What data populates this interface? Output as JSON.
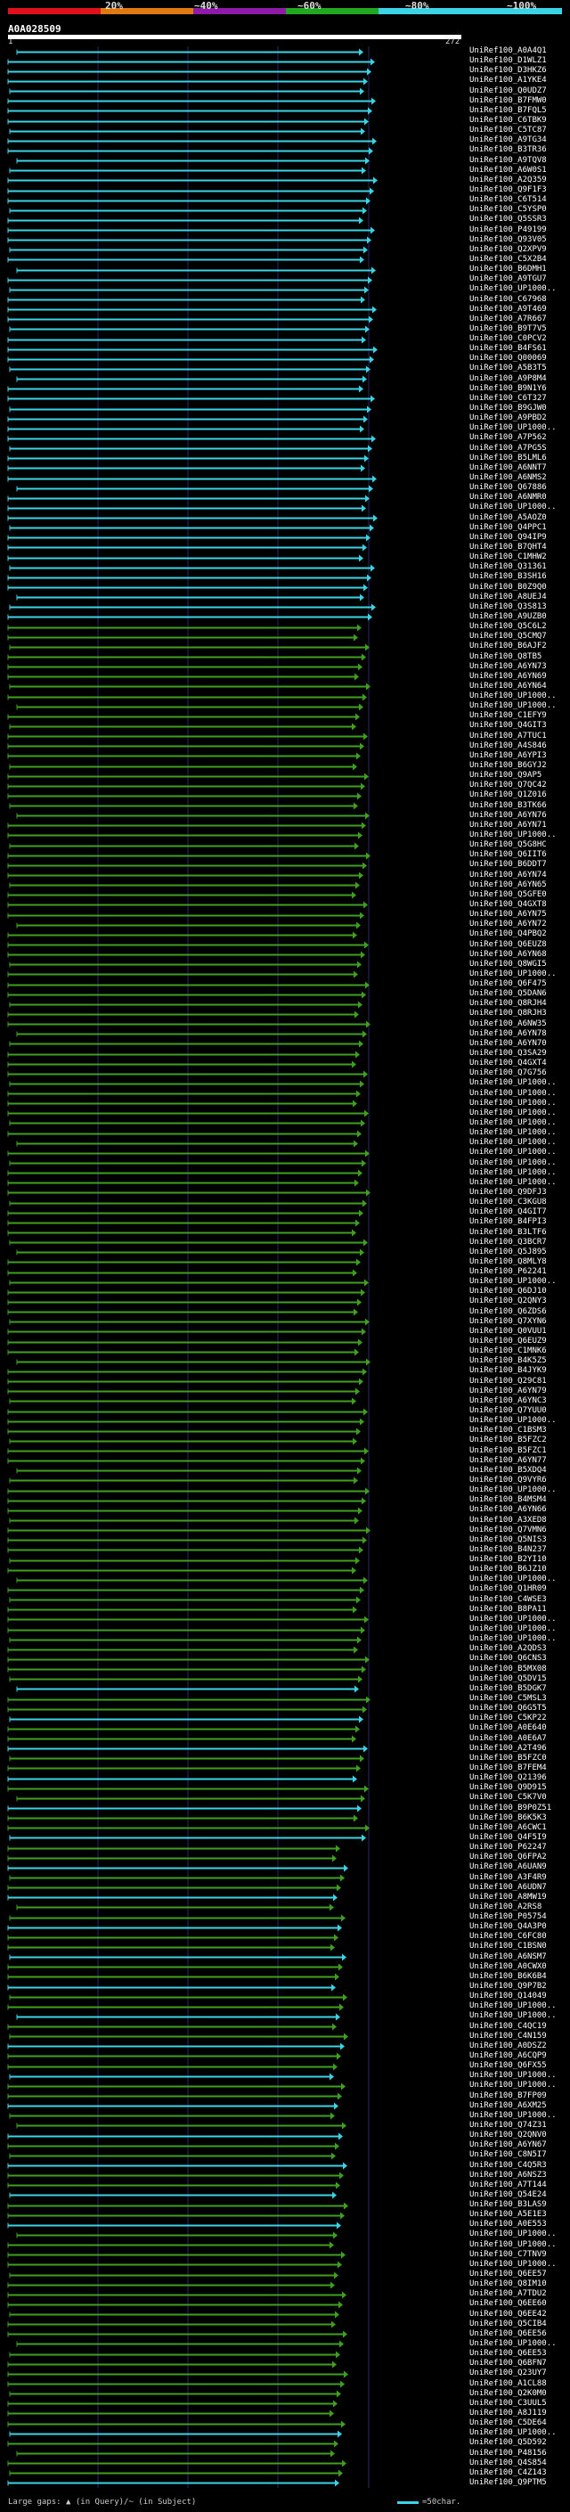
{
  "legend": {
    "bands": [
      {
        "label": "20%",
        "color": "#e0101c"
      },
      {
        "label": "~40%",
        "color": "#e07a10"
      },
      {
        "label": "~60%",
        "color": "#8e1aa8"
      },
      {
        "label": "~80%",
        "color": "#22a820"
      },
      {
        "label": "~100%",
        "color": "#3ad4e6"
      }
    ]
  },
  "query": {
    "id": "A0A028509",
    "start": "1",
    "end": "272",
    "length": 272
  },
  "footer": {
    "gaps_text": "Large gaps: ▲ (in Query)/~ (in Subject)",
    "scale_text": "=50char."
  },
  "hits": [
    "UniRef100_A0A4Q1",
    "UniRef100_D1WLZ1",
    "UniRef100_D3HKZ6",
    "UniRef100_A1YKE4",
    "UniRef100_Q0UDZ7",
    "UniRef100_B7FMW0",
    "UniRef100_B7FQL5",
    "UniRef100_C6TBK9",
    "UniRef100_C5TC87",
    "UniRef100_A9TG34",
    "UniRef100_B3TR36",
    "UniRef100_A9TQV8",
    "UniRef100_A6W0S1",
    "UniRef100_A2Q359",
    "UniRef100_Q9F1F3",
    "UniRef100_C6T514",
    "UniRef100_C5YSP0",
    "UniRef100_Q5SSR3",
    "UniRef100_P49199",
    "UniRef100_Q93V05",
    "UniRef100_Q2XPV9",
    "UniRef100_C5X2B4",
    "UniRef100_B6DMH1",
    "UniRef100_A9TGU7",
    "UniRef100_UP1000..",
    "UniRef100_C67968",
    "UniRef100_A9T469",
    "UniRef100_A7R667",
    "UniRef100_B9T7V5",
    "UniRef100_C0PCV2",
    "UniRef100_B4FS61",
    "UniRef100_Q00069",
    "UniRef100_A5B3T5",
    "UniRef100_A9P8M4",
    "UniRef100_B9N1Y6",
    "UniRef100_C6T327",
    "UniRef100_B9GJW0",
    "UniRef100_A9PBD2",
    "UniRef100_UP1000..",
    "UniRef100_A7P562",
    "UniRef100_A7PG5S",
    "UniRef100_B5LML6",
    "UniRef100_A6NNT7",
    "UniRef100_A6NMS2",
    "UniRef100_Q67886",
    "UniRef100_A6NMR0",
    "UniRef100_UP1000..",
    "UniRef100_A5AOZ0",
    "UniRef100_Q4PPC1",
    "UniRef100_Q94IP9",
    "UniRef100_B7QHT4",
    "UniRef100_C1MHW2",
    "UniRef100_Q31361",
    "UniRef100_B3SH16",
    "UniRef100_B0Z9Q0",
    "UniRef100_A8UEJ4",
    "UniRef100_Q3S813",
    "UniRef100_A9UZB0",
    "UniRef100_Q5C6L2",
    "UniRef100_Q5CMQ7",
    "UniRef100_B6AJF2",
    "UniRef100_Q8TB5",
    "UniRef100_A6YN73",
    "UniRef100_A6YN69",
    "UniRef100_A6YN64",
    "UniRef100_UP1000..",
    "UniRef100_UP1000..",
    "UniRef100_C1EFY9",
    "UniRef100_Q4GIT3",
    "UniRef100_A7TUC1",
    "UniRef100_A4S846",
    "UniRef100_A6YPI3",
    "UniRef100_B6GYJ2",
    "UniRef100_Q9AP5",
    "UniRef100_Q7QC42",
    "UniRef100_Q1Z016",
    "UniRef100_B3TK66",
    "UniRef100_A6YN76",
    "UniRef100_A6YN71",
    "UniRef100_UP1000..",
    "UniRef100_Q5G8HC",
    "UniRef100_Q6IIT6",
    "UniRef100_B6DDT7",
    "UniRef100_A6YN74",
    "UniRef100_A6YN65",
    "UniRef100_Q5GFE0",
    "UniRef100_Q4GXT8",
    "UniRef100_A6YN75",
    "UniRef100_A6YN72",
    "UniRef100_Q4PBQ2",
    "UniRef100_Q6EUZ8",
    "UniRef100_A6YN68",
    "UniRef100_Q8WGI5",
    "UniRef100_UP1000..",
    "UniRef100_Q6F475",
    "UniRef100_Q5DAN6",
    "UniRef100_Q8RJH4",
    "UniRef100_Q8RJH3",
    "UniRef100_A6NW35",
    "UniRef100_A6YN78",
    "UniRef100_A6YN70",
    "UniRef100_Q3SA29",
    "UniRef100_Q4GXT4",
    "UniRef100_Q7G756",
    "UniRef100_UP1000..",
    "UniRef100_UP1000..",
    "UniRef100_UP1000..",
    "UniRef100_UP1000..",
    "UniRef100_UP1000..",
    "UniRef100_UP1000..",
    "UniRef100_UP1000..",
    "UniRef100_UP1000..",
    "UniRef100_UP1000..",
    "UniRef100_UP1000..",
    "UniRef100_UP1000..",
    "UniRef100_Q9DFJ3",
    "UniRef100_C3KGU8",
    "UniRef100_Q4GIT7",
    "UniRef100_B4FPI3",
    "UniRef100_B3LTF6",
    "UniRef100_Q3BCR7",
    "UniRef100_Q5J895",
    "UniRef100_Q8MLY8",
    "UniRef100_P62241",
    "UniRef100_UP1000..",
    "UniRef100_Q6DJ10",
    "UniRef100_Q2QNY3",
    "UniRef100_Q6ZDS6",
    "UniRef100_Q7XYN6",
    "UniRef100_Q0VUU1",
    "UniRef100_Q6EUZ9",
    "UniRef100_C1MNK6",
    "UniRef100_B4K5Z5",
    "UniRef100_B4JYK9",
    "UniRef100_Q29C81",
    "UniRef100_A6YN79",
    "UniRef100_A6YNC3",
    "UniRef100_Q7YUU0",
    "UniRef100_UP1000..",
    "UniRef100_C1BSM3",
    "UniRef100_B5FZC2",
    "UniRef100_B5FZC1",
    "UniRef100_A6YN77",
    "UniRef100_B5XDQ4",
    "UniRef100_Q9VYR6",
    "UniRef100_UP1000..",
    "UniRef100_B4MSM4",
    "UniRef100_A6YN66",
    "UniRef100_A3XED8",
    "UniRef100_Q7VMN6",
    "UniRef100_Q5NIS3",
    "UniRef100_B4N237",
    "UniRef100_B2YI10",
    "UniRef100_B6JZ10",
    "UniRef100_UP1000..",
    "UniRef100_Q1HR09",
    "UniRef100_C4WSE3",
    "UniRef100_B8PA11",
    "UniRef100_UP1000..",
    "UniRef100_UP1000..",
    "UniRef100_UP1000..",
    "UniRef100_A2QDS3",
    "UniRef100_Q6CNS3",
    "UniRef100_B5MX08",
    "UniRef100_Q5DV15",
    "UniRef100_B5DGK7",
    "UniRef100_C5MSL3",
    "UniRef100_Q6G5T5",
    "UniRef100_C5KP22",
    "UniRef100_A0E640",
    "UniRef100_A0E6A7",
    "UniRef100_A2T496",
    "UniRef100_B5FZC0",
    "UniRef100_B7FEM4",
    "UniRef100_Q21396",
    "UniRef100_Q9D915",
    "UniRef100_C5K7V0",
    "UniRef100_B9P0Z51",
    "UniRef100_B6K5K3",
    "UniRef100_A6CWC1",
    "UniRef100_Q4F5I9",
    "UniRef100_P62247",
    "UniRef100_Q6FPA2",
    "UniRef100_A6UAN9",
    "UniRef100_A3F4R9",
    "UniRef100_A6UDN7",
    "UniRef100_A8MW19",
    "UniRef100_A2RS8",
    "UniRef100_P05754",
    "UniRef100_Q4A3P0",
    "UniRef100_C6FC80",
    "UniRef100_C1BSN0",
    "UniRef100_A6NSM7",
    "UniRef100_A0CWX0",
    "UniRef100_B6K6B4",
    "UniRef100_Q9P7B2",
    "UniRef100_Q14049",
    "UniRef100_UP1000..",
    "UniRef100_UP1000..",
    "UniRef100_C4QC19",
    "UniRef100_C4N159",
    "UniRef100_A0DSZ2",
    "UniRef100_A6CQP9",
    "UniRef100_Q6FX55",
    "UniRef100_UP1000..",
    "UniRef100_UP1000..",
    "UniRef100_B7FP09",
    "UniRef100_A6XM25",
    "UniRef100_UP1000..",
    "UniRef100_Q74Z31",
    "UniRef100_Q2QNV0",
    "UniRef100_A6YN67",
    "UniRef100_C8N5I7",
    "UniRef100_C4Q5R3",
    "UniRef100_A6NSZ3",
    "UniRef100_A7T144",
    "UniRef100_Q54E24",
    "UniRef100_B3LAS9",
    "UniRef100_A5E1E3",
    "UniRef100_A0E553",
    "UniRef100_UP1000..",
    "UniRef100_UP1000..",
    "UniRef100_C7TNV9",
    "UniRef100_UP1000..",
    "UniRef100_Q6EE57",
    "UniRef100_Q8IM10",
    "UniRef100_A7TDU2",
    "UniRef100_Q6EE60",
    "UniRef100_Q6EE42",
    "UniRef100_Q5CIB4",
    "UniRef100_Q6EE56",
    "UniRef100_UP1000..",
    "UniRef100_Q6EE53",
    "UniRef100_Q6BFN7",
    "UniRef100_Q23UY7",
    "UniRef100_A1CL88",
    "UniRef100_Q2K0M0",
    "UniRef100_C3UUL5",
    "UniRef100_A8J119",
    "UniRef100_C5DE64",
    "UniRef100_UP1000..",
    "UniRef100_Q5D592",
    "UniRef100_P48156",
    "UniRef100_Q4S854",
    "UniRef100_C4Z143",
    "UniRef100_Q9PTM5"
  ]
}
